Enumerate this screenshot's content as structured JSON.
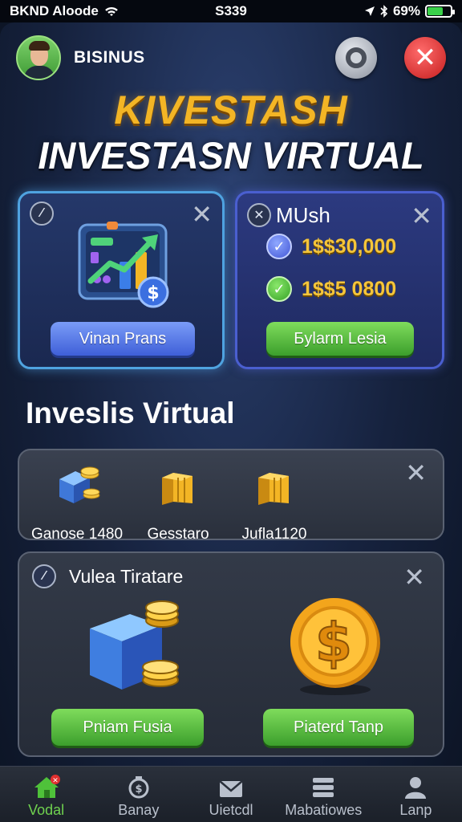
{
  "status_bar": {
    "carrier": "BKND Aloode",
    "time": "S339",
    "battery_text": "69%",
    "battery_level": 0.69,
    "icons": [
      "wifi-icon",
      "location-icon",
      "bluetooth-icon",
      "battery-icon"
    ]
  },
  "header": {
    "username": "BISINUS",
    "settings_icon": "settings-icon",
    "close_icon": "close-icon"
  },
  "titles": {
    "brand": "KIVESTASH",
    "subtitle": "INVESTASN VIRTUAL"
  },
  "plan_card": {
    "button_label": "Vinan Prans",
    "illustration": "growth-chart-icon"
  },
  "mush_card": {
    "title": "MUsh",
    "stats": [
      {
        "value": "1$$30,000",
        "icon": "check-blue-icon"
      },
      {
        "value": "1$$5 0800",
        "icon": "check-green-icon"
      }
    ],
    "button_label": "Бylarm Lesia"
  },
  "section_title": "Inveslis Virtual",
  "assets": [
    {
      "label": "Ganose 1480",
      "icon": "cube-coins-icon"
    },
    {
      "label": "Gesstaro",
      "icon": "gold-bars-icon"
    },
    {
      "label": "Jufla1120",
      "icon": "gold-bars-icon"
    }
  ],
  "featured_panel": {
    "title": "Vulea Tiratare",
    "buttons": [
      {
        "label": "Pniam Fusia"
      },
      {
        "label": "Piaterd Tanp"
      }
    ]
  },
  "nav": [
    {
      "label": "Vodal",
      "icon": "home-icon",
      "active": true
    },
    {
      "label": "Banay",
      "icon": "money-bag-icon",
      "active": false
    },
    {
      "label": "Uietcdl",
      "icon": "mail-icon",
      "active": false
    },
    {
      "label": "Mabatiowes",
      "icon": "list-icon",
      "active": false
    },
    {
      "label": "Lanp",
      "icon": "profile-icon",
      "active": false
    }
  ],
  "colors": {
    "accent_gold": "#f3b525",
    "active_green": "#6fd14f",
    "close_red": "#e03030"
  }
}
